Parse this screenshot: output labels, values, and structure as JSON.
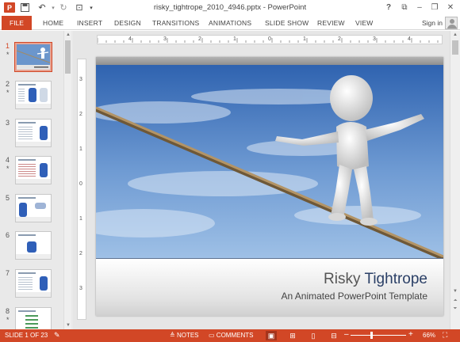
{
  "window": {
    "title": "risky_tightrope_2010_4946.pptx - PowerPoint",
    "controls": {
      "help": "?",
      "ribbon_display": "⧉",
      "minimize": "–",
      "restore": "❐",
      "close": "✕"
    }
  },
  "qat": {
    "app_icon": "P",
    "save_icon": "▣",
    "undo_icon": "↶",
    "redo_icon": "↻",
    "present_icon": "⊡",
    "customize_icon": "▾"
  },
  "ribbon": {
    "file_label": "FILE",
    "tabs": [
      "HOME",
      "INSERT",
      "DESIGN",
      "TRANSITIONS",
      "ANIMATIONS",
      "SLIDE SHOW",
      "REVIEW",
      "VIEW"
    ],
    "signin_label": "Sign in"
  },
  "thumbnails": [
    {
      "num": "1",
      "star": "*",
      "active": true
    },
    {
      "num": "2",
      "star": "*",
      "active": false
    },
    {
      "num": "3",
      "star": "",
      "active": false
    },
    {
      "num": "4",
      "star": "*",
      "active": false
    },
    {
      "num": "5",
      "star": "",
      "active": false
    },
    {
      "num": "6",
      "star": "",
      "active": false
    },
    {
      "num": "7",
      "star": "",
      "active": false
    },
    {
      "num": "8",
      "star": "*",
      "active": false
    }
  ],
  "ruler": {
    "horizontal": [
      "4",
      "3",
      "2",
      "1",
      "0",
      "1",
      "2",
      "3",
      "4"
    ],
    "vertical": [
      "3",
      "2",
      "1",
      "0",
      "1",
      "2",
      "3"
    ]
  },
  "slide": {
    "title_part1": "Risky ",
    "title_part2": "Tightrope",
    "subtitle": "An Animated PowerPoint Template"
  },
  "status": {
    "slide_info": "SLIDE 1 OF 23",
    "notes_label": "NOTES",
    "comments_label": "COMMENTS",
    "zoom_minus": "–",
    "zoom_plus": "+",
    "zoom_level": "66%"
  },
  "colors": {
    "accent": "#d24726",
    "title_dark": "#2a3f66",
    "sky": "#4d7fc0"
  }
}
